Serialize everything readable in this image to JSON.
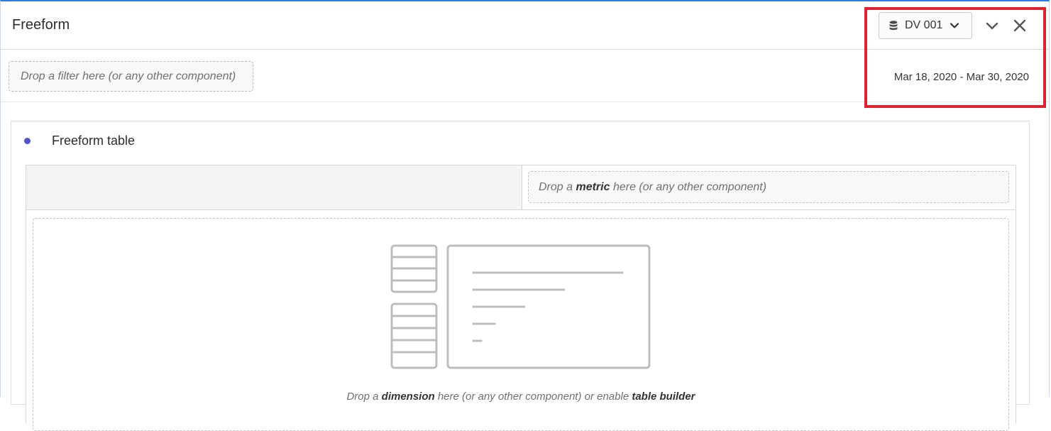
{
  "panel": {
    "title": "Freeform",
    "data_view_label": "DV 001",
    "icons": {
      "data_view": "database-icon",
      "data_view_chevron": "chevron-down-icon",
      "collapse": "chevron-down-icon",
      "close": "close-icon"
    },
    "filter_placeholder": "Drop a filter here (or any other component)",
    "date_range": "Mar 18, 2020 - Mar 30, 2020"
  },
  "visualization": {
    "title": "Freeform table",
    "status_dot_color": "#5253c9",
    "metric_drop": {
      "prefix": "Drop a ",
      "keyword": "metric",
      "suffix": " here (or any other component)"
    },
    "dimension_drop": {
      "prefix": "Drop a ",
      "keyword": "dimension",
      "middle": " here (or any other component) or enable ",
      "link": "table builder"
    }
  },
  "colors": {
    "accent_border": "#2c7be5",
    "highlight": "#e0212f"
  }
}
